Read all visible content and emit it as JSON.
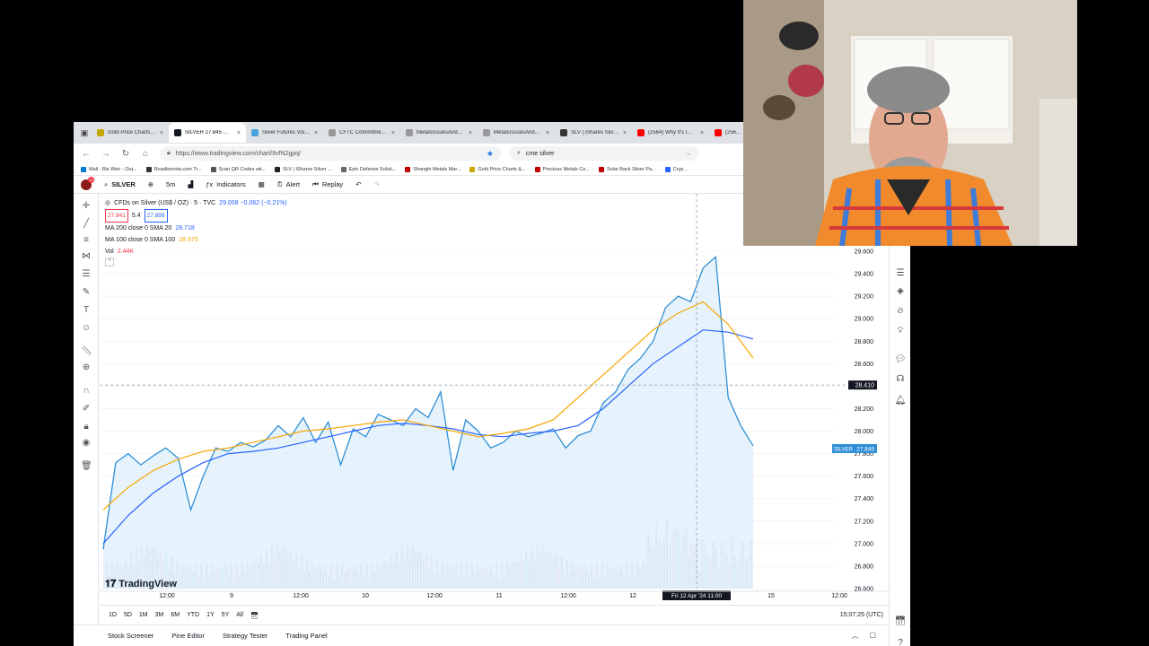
{
  "browser": {
    "tabs": [
      {
        "label": "Gold Price Charts a...",
        "icon": "globe-icon",
        "color": "#c8a600"
      },
      {
        "label": "SILVER 27.845 ▼ -...",
        "icon": "tradingview-icon",
        "color": "#131722",
        "active": true
      },
      {
        "label": "Silver Futures Volu...",
        "icon": "globe-icon",
        "color": "#4aa3df"
      },
      {
        "label": "CFTC Commitments of...",
        "icon": "globe-icon",
        "color": "#999999"
      },
      {
        "label": "MetalsIssuesAndStopsI...",
        "icon": "globe-icon",
        "color": "#999999"
      },
      {
        "label": "MetalsIssuesAndStopsI...",
        "icon": "globe-icon",
        "color": "#999999"
      },
      {
        "label": "SLV | iShares Silver...",
        "icon": "globe-icon",
        "color": "#333333"
      },
      {
        "label": "(2564) Why It's Imp...",
        "icon": "youtube-icon",
        "color": "#ff0000"
      },
      {
        "label": "(256...",
        "icon": "youtube-icon",
        "color": "#ff0000"
      }
    ],
    "url": "https://www.tradingview.com/chart/9vfN2gpq/",
    "search": "cme silver",
    "bookmarks": [
      {
        "label": "Mail - Bix Weir - Out...",
        "color": "#0078d4"
      },
      {
        "label": "Roadtoroota.com Tr...",
        "color": "#333333"
      },
      {
        "label": "Scan QR Codes wit...",
        "color": "#555555"
      },
      {
        "label": "SLV | iShares Silver ...",
        "color": "#222222"
      },
      {
        "label": "Epic Defense Soluti...",
        "color": "#666666"
      },
      {
        "label": "Shanghi Metals Mar...",
        "color": "#c00000"
      },
      {
        "label": "Gold Price Charts &...",
        "color": "#c8a600"
      },
      {
        "label": "Precious Metals Co...",
        "color": "#c00000"
      },
      {
        "label": "Solar Back Silver Pa...",
        "color": "#c00000"
      },
      {
        "label": "Cryp...",
        "color": "#2962ff"
      }
    ]
  },
  "toolbar": {
    "badge": "11",
    "symbol": "SILVER",
    "interval": "5m",
    "indicators": "Indicators",
    "alert": "Alert",
    "replay": "Replay"
  },
  "legend": {
    "title": "CFDs on Silver (US$ / OZ) · 5 · TVC",
    "headline": "29.008  −0.062 (−0.21%)",
    "bid": "27.841",
    "spread": "5.4",
    "ask": "27.899",
    "ma1_label": "MA 200 close 0 SMA 20",
    "ma1_value": "28.718",
    "ma2_label": "MA 100 close 0 SMA 100",
    "ma2_value": "28.975",
    "vol_label": "Vol",
    "vol_value": "2.44K"
  },
  "brand": "TradingView",
  "chart_data": {
    "type": "line",
    "title": "CFDs on Silver (US$ / OZ) · 5 · TVC",
    "x_ticks": [
      "12:00",
      "9",
      "12:00",
      "10",
      "12:00",
      "11",
      "12:00",
      "12",
      "15",
      "12:00"
    ],
    "y_ticks": [
      "29.600",
      "29.400",
      "29.200",
      "29.000",
      "28.800",
      "28.600",
      "28.400",
      "28.200",
      "28.000",
      "27.800",
      "27.600",
      "27.400",
      "27.200",
      "27.000",
      "26.800",
      "26.600"
    ],
    "ylim": [
      26.6,
      29.6
    ],
    "crosshair_price": "28.410",
    "crosshair_time": "Fri 12 Apr '24  11:00",
    "last_price_label": "SILVER",
    "last_price": "27.845",
    "colors": {
      "price": "#2f8fd6",
      "sma20": "#2962ff",
      "sma100": "#f7a600",
      "volume": "#c9cdd6"
    },
    "series": [
      {
        "name": "SILVER",
        "values": [
          26.95,
          27.72,
          27.8,
          27.7,
          27.78,
          27.85,
          27.76,
          27.3,
          27.6,
          27.85,
          27.82,
          27.9,
          27.86,
          27.92,
          28.05,
          27.95,
          28.12,
          27.9,
          28.08,
          27.7,
          28.02,
          27.95,
          28.15,
          28.1,
          28.05,
          28.2,
          28.12,
          28.35,
          27.65,
          28.1,
          28.0,
          27.85,
          27.9,
          28.0,
          27.95,
          27.98,
          28.02,
          27.85,
          27.96,
          28.0,
          28.25,
          28.35,
          28.55,
          28.65,
          28.8,
          29.1,
          29.2,
          29.15,
          29.45,
          29.55,
          28.3,
          28.05,
          27.87
        ]
      },
      {
        "name": "MA 200 close 0 SMA 20",
        "values": [
          27.0,
          27.25,
          27.45,
          27.6,
          27.72,
          27.8,
          27.82,
          27.85,
          27.9,
          27.95,
          28.0,
          28.05,
          28.07,
          28.05,
          28.02,
          27.97,
          27.95,
          27.98,
          28.0,
          28.05,
          28.2,
          28.4,
          28.6,
          28.75,
          28.9,
          28.88,
          28.82
        ]
      },
      {
        "name": "MA 100 close 0 SMA 100",
        "values": [
          27.3,
          27.5,
          27.65,
          27.75,
          27.82,
          27.85,
          27.9,
          27.95,
          28.0,
          28.02,
          28.05,
          28.08,
          28.1,
          28.05,
          28.0,
          27.95,
          27.98,
          28.02,
          28.1,
          28.3,
          28.5,
          28.7,
          28.9,
          29.05,
          29.15,
          28.95,
          28.65
        ]
      }
    ]
  },
  "timeframes": [
    "1D",
    "5D",
    "1M",
    "3M",
    "6M",
    "YTD",
    "1Y",
    "5Y",
    "All"
  ],
  "clock": "15:07:25 (UTC)",
  "bottom_tabs": [
    "Stock Screener",
    "Pine Editor",
    "Strategy Tester",
    "Trading Panel"
  ]
}
